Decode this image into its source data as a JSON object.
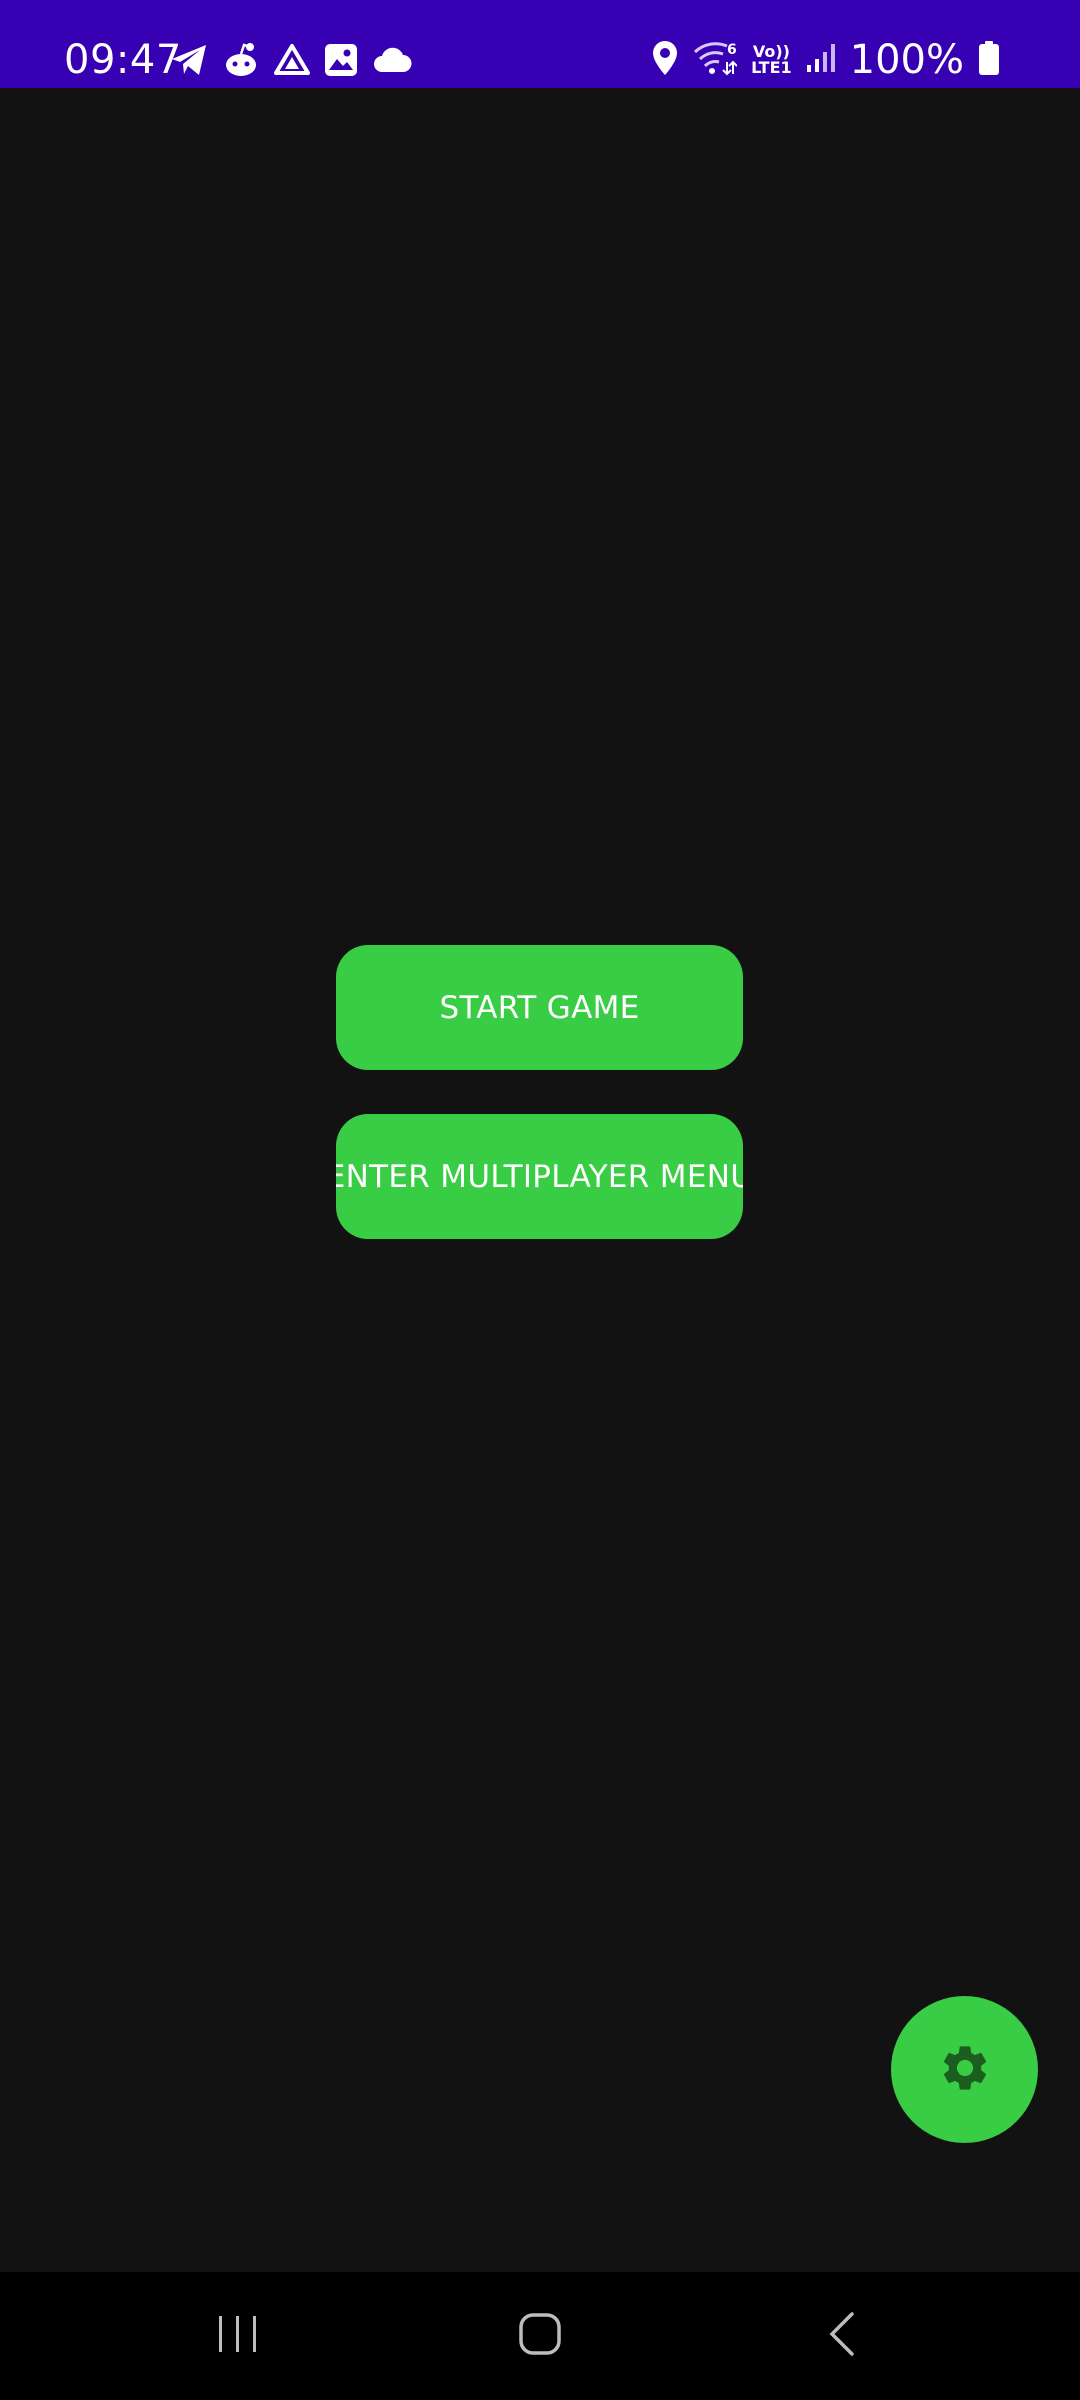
{
  "status_bar": {
    "time": "09:47",
    "battery": "100%",
    "network_top": "Vo))",
    "network_bottom": "LTE1",
    "wifi_badge": "6",
    "left_icons": [
      "telegram-icon",
      "reddit-icon",
      "drive-icon",
      "gallery-icon",
      "cloud-icon"
    ],
    "right_icons": [
      "location-icon",
      "wifi-icon",
      "signal-icon",
      "battery-icon"
    ]
  },
  "main": {
    "start_button_label": "START GAME",
    "multiplayer_button_label": "ENTER MULTIPLAYER MENU"
  },
  "fab": {
    "icon": "gear-icon"
  },
  "nav_bar": {
    "icons": [
      "recents-icon",
      "home-icon",
      "back-icon"
    ]
  },
  "colors": {
    "status_bar": "#3700b3",
    "background": "#121212",
    "accent": "#39cc45",
    "button_text": "#ffffff",
    "gear": "#1b5e20"
  }
}
